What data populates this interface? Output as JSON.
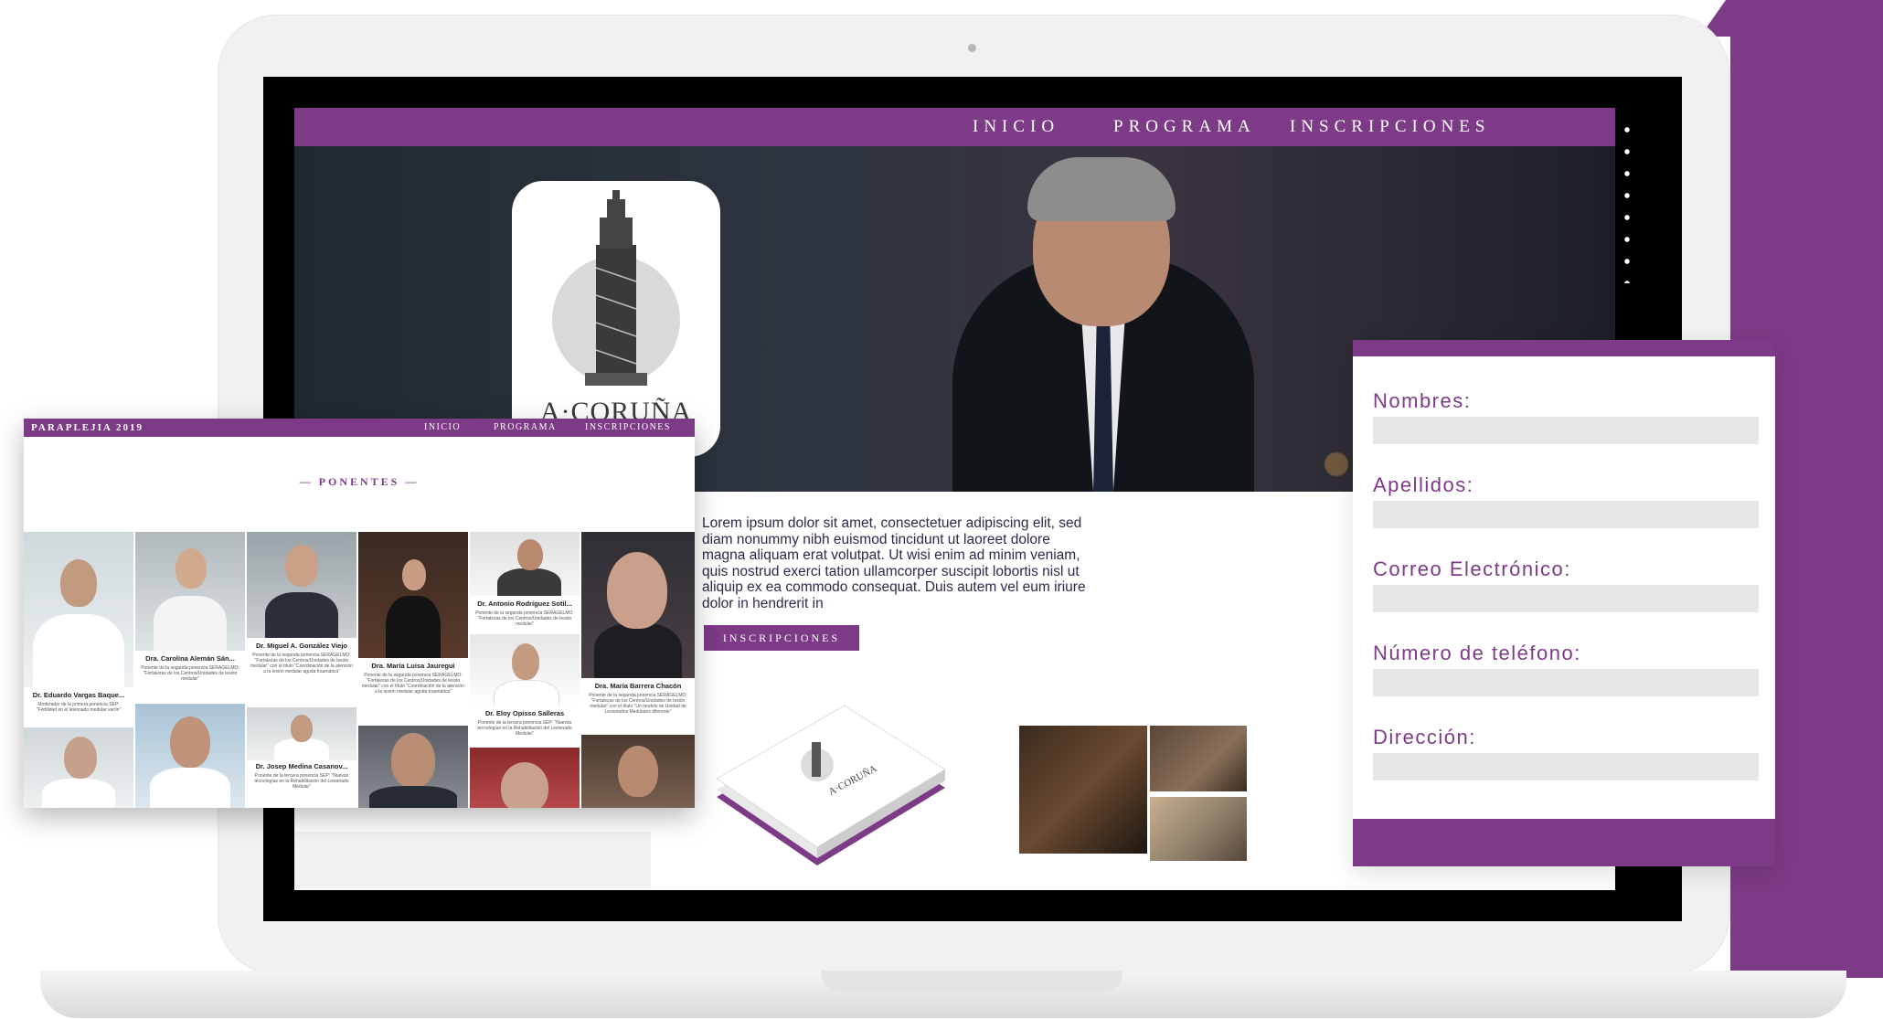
{
  "colors": {
    "accent": "#7d3a86",
    "frame": "#f1f1f1",
    "input_fill": "#e6e6e6"
  },
  "site": {
    "nav": [
      "INICIO",
      "PROGRAMA",
      "INSCRIPCIONES"
    ],
    "logo_text": "A·CORUÑA",
    "lorem": "Lorem ipsum dolor sit amet, consectetuer adipiscing elit, sed diam nonummy nibh euismod tincidunt ut laoreet dolore magna aliquam erat volutpat. Ut wisi enim ad minim veniam, quis nostrud exerci tation ullamcorper suscipit lobortis nisl ut aliquip ex ea commodo consequat. Duis autem vel eum iriure dolor in hendrerit in",
    "button": "INSCRIPCIONES",
    "booklet_text": "A·CORUÑA"
  },
  "form": {
    "fields": [
      "Nombres:",
      "Apellidos:",
      "Correo Electrónico:",
      "Número de teléfono:",
      "Dirección:"
    ]
  },
  "overlay": {
    "brand": "PARAPLEJIA 2019",
    "nav": [
      "INICIO",
      "PROGRAMA",
      "INSCRIPCIONES"
    ],
    "section": "— PONENTES —",
    "speakers": [
      {
        "name": "Dr. Eduardo Vargas Baque...",
        "desc": "Moderador de la primera ponencia SEP: \"Fertilidad en el lesionado medular varón\""
      },
      {
        "name": "Dra. Carolina Alemán Sán...",
        "desc": "Ponente de la segunda ponencia SERAGELMO: \"Fortalezas de los Centros/Unidades de lesión medular\""
      },
      {
        "name": "Dr. Miguel A. González Viejo",
        "desc": "Ponente de la segunda ponencia SERAGELMO: \"Fortalezas de los Centros/Unidades de lesión medular\" con el título \"Coordinación de la atención a la lesión medular aguda traumática\""
      },
      {
        "name": "Dra. María Luisa Jauregui",
        "desc": "Ponente de la segunda ponencia SERAGELMO: \"Fortalezas de los Centros/Unidades de lesión medular\" con el título \"Coordinación de la atención a la lesión medular aguda traumática\""
      },
      {
        "name": "Dr. Antonio Rodríguez Sotil...",
        "desc": "Ponente de la segunda ponencia SERAGELMO: \"Fortalezas de los Centros/Unidades de lesión medular\""
      },
      {
        "name": "Dra. María Barrera Chacón",
        "desc": "Ponente de la segunda ponencia SERAGELMO: \"Fortalezas de los Centros/Unidades de lesión medular\" con el título \"Un modelo de Unidad de Lesionados Medulares diferente\""
      },
      {
        "name": "Dr. Eloy Opisso Salleras",
        "desc": "Ponente de la tercera ponencia SEP: \"Nuevas tecnologías en la Rehabilitación del Lesionado Medular\""
      },
      {
        "name": "Dr. Josep Medina Casanov...",
        "desc": "Ponente de la tercera ponencia SEP: \"Nuevas tecnologías en la Rehabilitación del Lesionado Medular\""
      }
    ]
  }
}
